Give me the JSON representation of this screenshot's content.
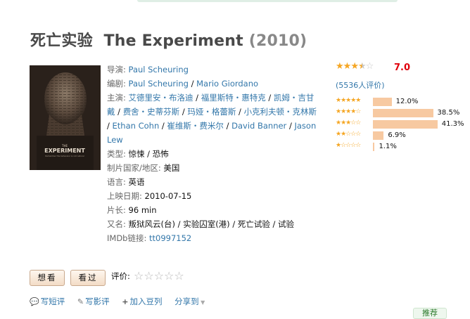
{
  "movie": {
    "title_cn": "死亡实验",
    "title_en": "The Experiment",
    "year": "(2010)",
    "poster_title": "EXPERIMENT",
    "poster_tagline": "THE",
    "poster_subtitle": "Remember the behaviour is not natural"
  },
  "info": {
    "director_label": "导演:",
    "director": "Paul Scheuring",
    "writer_label": "编剧:",
    "writers": [
      "Paul Scheuring",
      "Mario Giordano"
    ],
    "cast_label": "主演:",
    "cast": [
      "艾德里安・布洛迪",
      "福里斯特・惠特克",
      "凯姆・吉甘戴",
      "费舍・史蒂芬斯",
      "玛娅・格蕾斯",
      "小克利夫顿・克林斯",
      "Ethan Cohn",
      "崔维斯・费米尔",
      "David Banner",
      "Jason Lew"
    ],
    "genre_label": "类型:",
    "genres": [
      "惊悚",
      "恐怖"
    ],
    "country_label": "制片国家/地区:",
    "country": "美国",
    "language_label": "语言:",
    "language": "英语",
    "release_label": "上映日期:",
    "release": "2010-07-15",
    "runtime_label": "片长:",
    "runtime": "96 min",
    "aka_label": "又名:",
    "aka": "叛狱风云(台) / 实验囚室(港) / 死亡试验 / 试验",
    "imdb_label": "IMDb链接:",
    "imdb": "tt0997152"
  },
  "rating": {
    "score": "7.0",
    "stars_value": 3.5,
    "votes": "(5536人评价)",
    "distribution": [
      {
        "stars": 5,
        "percent": 12.0,
        "label": "12.0%"
      },
      {
        "stars": 4,
        "percent": 38.5,
        "label": "38.5%"
      },
      {
        "stars": 3,
        "percent": 41.3,
        "label": "41.3%"
      },
      {
        "stars": 2,
        "percent": 6.9,
        "label": "6.9%"
      },
      {
        "stars": 1,
        "percent": 1.1,
        "label": "1.1%"
      }
    ],
    "colors": {
      "star": "#f5a623",
      "bar": "#f7c9a1",
      "score": "#e0000c"
    }
  },
  "buttons": {
    "want": "想看",
    "seen": "看过",
    "rate_label": "评价:"
  },
  "actions": {
    "short_review": "写短评",
    "review": "写影评",
    "add_list": "加入豆列",
    "share": "分享到"
  },
  "recommend": "推荐"
}
